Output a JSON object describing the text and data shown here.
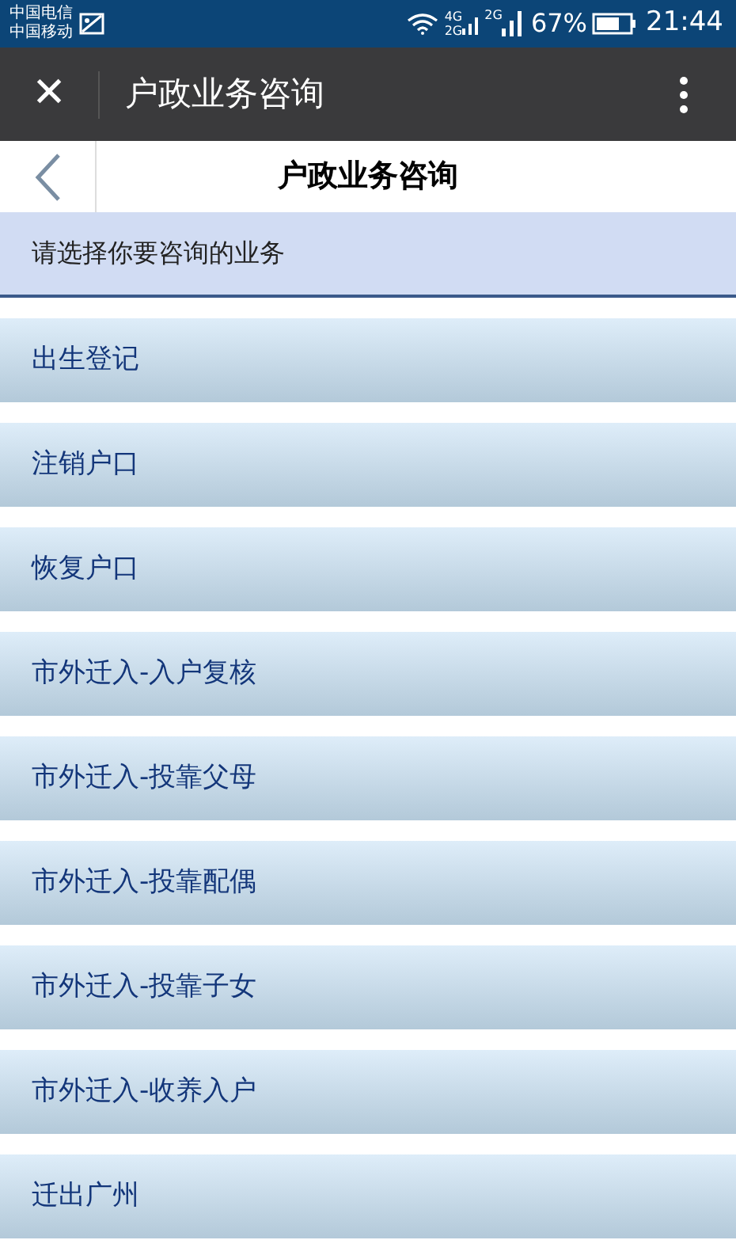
{
  "status_bar": {
    "carriers": [
      "中国电信",
      "中国移动"
    ],
    "net_labels": [
      "4G",
      "2G",
      "2G"
    ],
    "battery": "67%",
    "time": "21:44"
  },
  "toolbar": {
    "close": "✕",
    "title": "户政业务咨询"
  },
  "header": {
    "title": "户政业务咨询"
  },
  "prompt": "请选择你要咨询的业务",
  "items": [
    {
      "label": "出生登记"
    },
    {
      "label": "注销户口"
    },
    {
      "label": "恢复户口"
    },
    {
      "label": "市外迁入-入户复核"
    },
    {
      "label": "市外迁入-投靠父母"
    },
    {
      "label": "市外迁入-投靠配偶"
    },
    {
      "label": "市外迁入-投靠子女"
    },
    {
      "label": "市外迁入-收养入户"
    },
    {
      "label": "迁出广州"
    }
  ]
}
